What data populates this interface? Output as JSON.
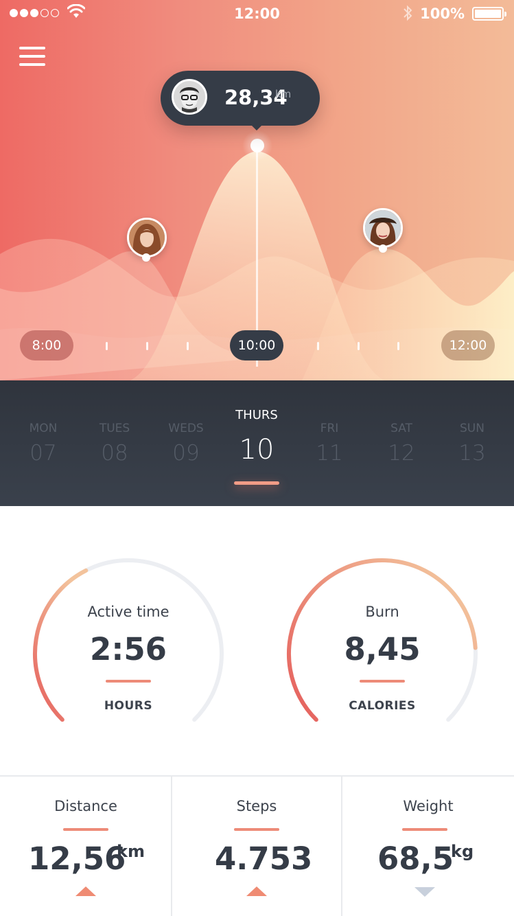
{
  "status_bar": {
    "time": "12:00",
    "battery_percent": "100%",
    "signal_bars_filled": 3,
    "signal_bars_total": 5
  },
  "menu": {
    "icon": "hamburger-menu-icon"
  },
  "tooltip": {
    "value": "28,34",
    "unit": "km"
  },
  "timeline": {
    "labels": [
      "8:00",
      "10:00",
      "12:00"
    ],
    "selected": "10:00"
  },
  "days": [
    {
      "name": "MON",
      "num": "07"
    },
    {
      "name": "TUES",
      "num": "08"
    },
    {
      "name": "WEDS",
      "num": "09"
    },
    {
      "name": "THURS",
      "num": "10",
      "active": true
    },
    {
      "name": "FRI",
      "num": "11"
    },
    {
      "name": "SAT",
      "num": "12"
    },
    {
      "name": "SUN",
      "num": "13"
    }
  ],
  "gauges": {
    "active_time": {
      "label": "Active time",
      "value": "2:56",
      "unit": "HOURS",
      "progress": 0.4
    },
    "burn": {
      "label": "Burn",
      "value": "8,45",
      "unit": "CALORIES",
      "progress": 0.82
    }
  },
  "stats": {
    "distance": {
      "label": "Distance",
      "value": "12,56",
      "unit": "km",
      "trend": "up"
    },
    "steps": {
      "label": "Steps",
      "value": "4.753",
      "unit": "",
      "trend": "up"
    },
    "weight": {
      "label": "Weight",
      "value": "68,5",
      "unit": "kg",
      "trend": "down"
    }
  },
  "colors": {
    "accent": "#ed8b78",
    "dark": "#353c47",
    "gauge_track": "#eceef2",
    "trend_up": "#ef8b73",
    "trend_down": "#c8d0dc"
  }
}
